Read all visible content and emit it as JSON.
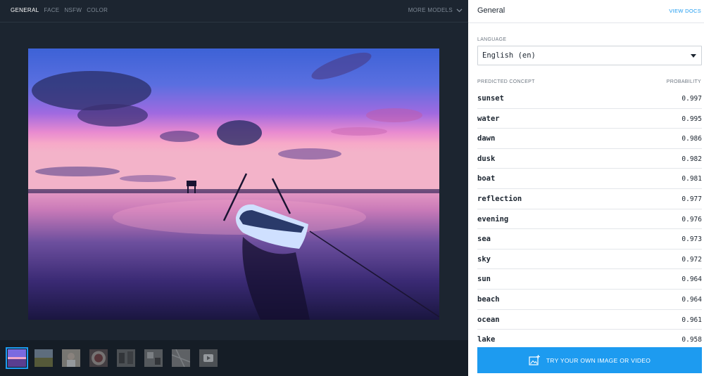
{
  "left": {
    "tabs": [
      {
        "label": "GENERAL",
        "active": true
      },
      {
        "label": "FACE",
        "active": false
      },
      {
        "label": "NSFW",
        "active": false
      },
      {
        "label": "COLOR",
        "active": false
      }
    ],
    "more_models_label": "MORE MODELS",
    "thumbnails": [
      {
        "icon": "sunset-thumbnail",
        "active": true
      },
      {
        "icon": "field-thumbnail",
        "active": false
      },
      {
        "icon": "portrait-thumbnail",
        "active": false
      },
      {
        "icon": "plate-thumbnail",
        "active": false
      },
      {
        "icon": "street-thumbnail",
        "active": false
      },
      {
        "icon": "room-thumbnail",
        "active": false
      },
      {
        "icon": "map-thumbnail",
        "active": false
      },
      {
        "icon": "video-thumbnail",
        "active": false
      }
    ]
  },
  "right": {
    "title": "General",
    "view_docs_label": "VIEW DOCS",
    "language_label": "LANGUAGE",
    "language_value": "English (en)",
    "concept_header": "PREDICTED CONCEPT",
    "probability_header": "PROBABILITY",
    "concepts": [
      {
        "name": "sunset",
        "probability": "0.997"
      },
      {
        "name": "water",
        "probability": "0.995"
      },
      {
        "name": "dawn",
        "probability": "0.986"
      },
      {
        "name": "dusk",
        "probability": "0.982"
      },
      {
        "name": "boat",
        "probability": "0.981"
      },
      {
        "name": "reflection",
        "probability": "0.977"
      },
      {
        "name": "evening",
        "probability": "0.976"
      },
      {
        "name": "sea",
        "probability": "0.973"
      },
      {
        "name": "sky",
        "probability": "0.972"
      },
      {
        "name": "sun",
        "probability": "0.964"
      },
      {
        "name": "beach",
        "probability": "0.964"
      },
      {
        "name": "ocean",
        "probability": "0.961"
      },
      {
        "name": "lake",
        "probability": "0.958"
      }
    ],
    "try_button_label": "TRY YOUR OWN IMAGE OR VIDEO"
  },
  "colors": {
    "accent": "#1d9bf0",
    "dark_bg": "#1c2530",
    "panel_bg": "#ffffff"
  }
}
